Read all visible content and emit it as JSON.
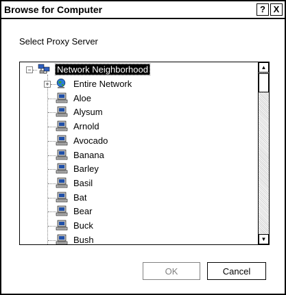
{
  "window": {
    "title": "Browse for Computer",
    "help_label": "?",
    "close_label": "X"
  },
  "instruction": "Select Proxy Server",
  "tree": {
    "root": {
      "label": "Network Neighborhood",
      "expander": "−",
      "icon": "network-neighborhood-icon",
      "selected": true
    },
    "items": [
      {
        "label": "Entire Network",
        "expander": "+",
        "icon": "globe-icon"
      },
      {
        "label": "Aloe",
        "icon": "computer-icon"
      },
      {
        "label": "Alysum",
        "icon": "computer-icon"
      },
      {
        "label": "Arnold",
        "icon": "computer-icon"
      },
      {
        "label": "Avocado",
        "icon": "computer-icon"
      },
      {
        "label": "Banana",
        "icon": "computer-icon"
      },
      {
        "label": "Barley",
        "icon": "computer-icon"
      },
      {
        "label": "Basil",
        "icon": "computer-icon"
      },
      {
        "label": "Bat",
        "icon": "computer-icon"
      },
      {
        "label": "Bear",
        "icon": "computer-icon"
      },
      {
        "label": "Buck",
        "icon": "computer-icon"
      },
      {
        "label": "Bush",
        "icon": "computer-icon"
      }
    ]
  },
  "scrollbar": {
    "up_arrow": "▲",
    "down_arrow": "▼"
  },
  "buttons": {
    "ok_label": "OK",
    "cancel_label": "Cancel",
    "ok_enabled": false
  }
}
